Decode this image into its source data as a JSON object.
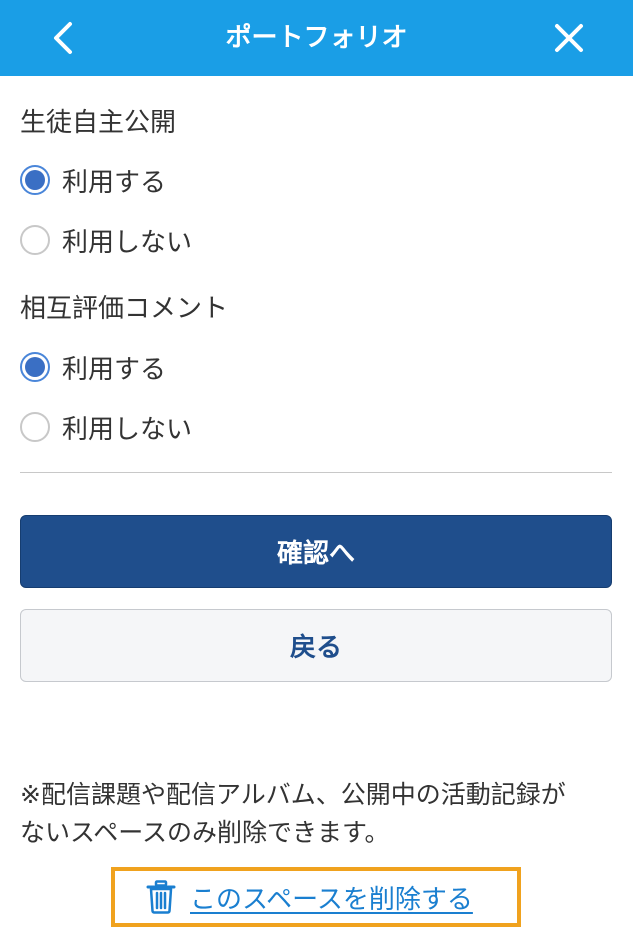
{
  "header": {
    "title": "ポートフォリオ",
    "back_icon": "chevron-left-icon",
    "close_icon": "close-icon",
    "color": "#1a9ee6"
  },
  "sections": [
    {
      "label": "生徒自主公開",
      "options": [
        {
          "label": "利用する",
          "checked": true
        },
        {
          "label": "利用しない",
          "checked": false
        }
      ]
    },
    {
      "label": "相互評価コメント",
      "options": [
        {
          "label": "利用する",
          "checked": true
        },
        {
          "label": "利用しない",
          "checked": false
        }
      ]
    }
  ],
  "buttons": {
    "confirm_label": "確認へ",
    "back_label": "戻る",
    "confirm_color": "#1f4e8c"
  },
  "note": {
    "line1": "※配信課題や配信アルバム、公開中の活動記録が",
    "line2": "ないスペースのみ削除できます。"
  },
  "delete": {
    "label": "このスペースを削除する",
    "icon": "trash-icon",
    "link_color": "#1a7fd0",
    "highlight_color": "#f0a21e"
  }
}
